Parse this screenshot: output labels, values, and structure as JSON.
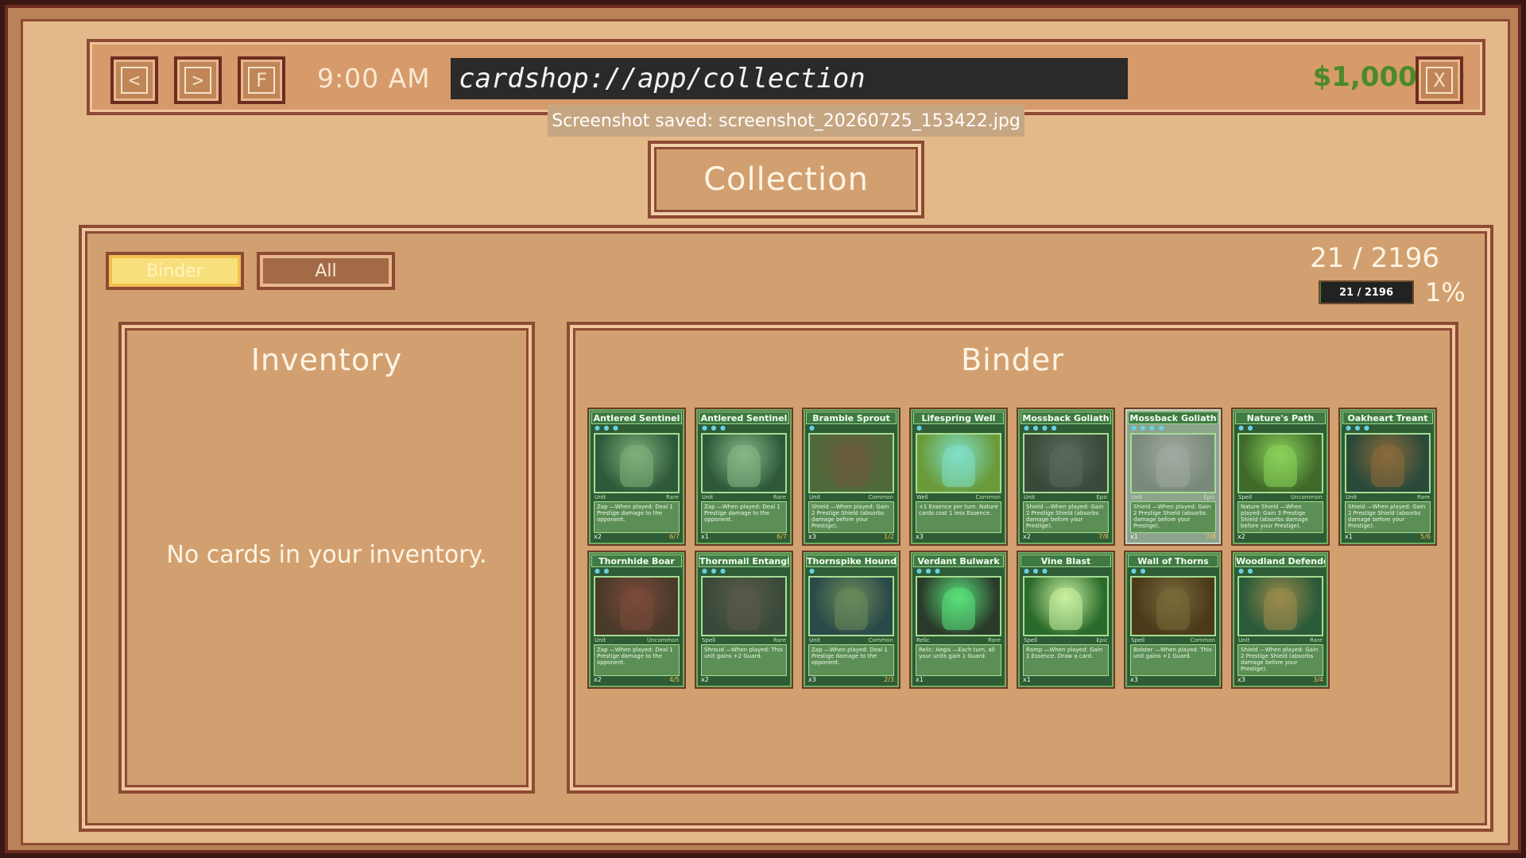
{
  "topbar": {
    "back_label": "<",
    "forward_label": ">",
    "fav_label": "F",
    "clock": "9:00 AM",
    "address": "cardshop://app/collection",
    "money": "$1,000.00",
    "close_label": "X"
  },
  "toast": "Screenshot saved: screenshot_20260725_153422.jpg",
  "page_title": "Collection",
  "filters": {
    "binder_label": "Binder",
    "all_label": "All",
    "active": "Binder"
  },
  "progress": {
    "count_text": "21 / 2196",
    "bar_label": "21 / 2196",
    "fraction": 0.0096,
    "percent_text": "1%"
  },
  "inventory": {
    "title": "Inventory",
    "empty_message": "No cards in your inventory."
  },
  "binder": {
    "title": "Binder",
    "cards": [
      {
        "name": "Antlered Sentinel",
        "pips": "● ● ●",
        "type": "Unit",
        "rarity": "Rare",
        "text": "Zap —When played: Deal 1 Prestige damage to the opponent.",
        "qty": "x2",
        "stats": "6/7",
        "art_bg": "#2f5a3a",
        "art_fg": "#7fb07a",
        "faded": false
      },
      {
        "name": "Antlered Sentinel",
        "pips": "● ● ●",
        "type": "Unit",
        "rarity": "Rare",
        "text": "Zap —When played: Deal 1 Prestige damage to the opponent.",
        "qty": "x1",
        "stats": "6/7",
        "art_bg": "#2f5a3a",
        "art_fg": "#86b886",
        "faded": false
      },
      {
        "name": "Bramble Sprout",
        "pips": "●",
        "type": "Unit",
        "rarity": "Common",
        "text": "Shield —When played: Gain 2 Prestige Shield (absorbs damage before your Prestige).",
        "qty": "x3",
        "stats": "1/2",
        "art_bg": "#4f6a3a",
        "art_fg": "#6a5a3a",
        "faded": false
      },
      {
        "name": "Lifespring Well",
        "pips": "●",
        "type": "Well",
        "rarity": "Common",
        "text": "+1 Essence per turn. Nature cards cost 1 less Essence.",
        "qty": "x3",
        "stats": "",
        "art_bg": "#6a9a3a",
        "art_fg": "#7fe0c8",
        "faded": false
      },
      {
        "name": "Mossback Goliath",
        "pips": "● ● ● ●",
        "type": "Unit",
        "rarity": "Epic",
        "text": "Shield —When played: Gain 2 Prestige Shield (absorbs damage before your Prestige).",
        "qty": "x2",
        "stats": "7/8",
        "art_bg": "#3a4a3a",
        "art_fg": "#5a6a5a",
        "faded": false
      },
      {
        "name": "Mossback Goliath",
        "pips": "● ● ● ●",
        "type": "Unit",
        "rarity": "Epic",
        "text": "Shield —When played: Gain 2 Prestige Shield (absorbs damage before your Prestige).",
        "qty": "x1",
        "stats": "7/8",
        "art_bg": "#7a8a7a",
        "art_fg": "#a0aaa0",
        "faded": true
      },
      {
        "name": "Nature's Path",
        "pips": "● ●",
        "type": "Spell",
        "rarity": "Uncommon",
        "text": "Nature Shield —When played: Gain 3 Prestige Shield (absorbs damage before your Prestige).",
        "qty": "x2",
        "stats": "",
        "art_bg": "#3f6a2a",
        "art_fg": "#8ad25a",
        "faded": false
      },
      {
        "name": "Oakheart Treant",
        "pips": "● ● ●",
        "type": "Unit",
        "rarity": "Rare",
        "text": "Shield —When played: Gain 2 Prestige Shield (absorbs damage before your Prestige).",
        "qty": "x1",
        "stats": "5/6",
        "art_bg": "#2a4a3a",
        "art_fg": "#8a6a3a",
        "faded": false
      },
      {
        "name": "Thornhide Boar",
        "pips": "● ●",
        "type": "Unit",
        "rarity": "Uncommon",
        "text": "Zap —When played: Deal 1 Prestige damage to the opponent.",
        "qty": "x2",
        "stats": "4/5",
        "art_bg": "#4a3a2a",
        "art_fg": "#7a4a3a",
        "faded": false
      },
      {
        "name": "Thornmail Entanglement",
        "pips": "● ● ●",
        "type": "Spell",
        "rarity": "Rare",
        "text": "Shroud —When played: This unit gains +2 Guard.",
        "qty": "x2",
        "stats": "",
        "art_bg": "#3a4a3a",
        "art_fg": "#5a5a4a",
        "faded": false
      },
      {
        "name": "Thornspike Hound",
        "pips": "●",
        "type": "Unit",
        "rarity": "Common",
        "text": "Zap —When played: Deal 1 Prestige damage to the opponent.",
        "qty": "x3",
        "stats": "2/3",
        "art_bg": "#2a4a4a",
        "art_fg": "#6a8a5a",
        "faded": false
      },
      {
        "name": "Verdant Bulwark",
        "pips": "● ● ●",
        "type": "Relic",
        "rarity": "Rare",
        "text": "Relic: Aegis —Each turn, all your units gain 1 Guard.",
        "qty": "x1",
        "stats": "",
        "art_bg": "#2a3a2a",
        "art_fg": "#5ae07a",
        "faded": false
      },
      {
        "name": "Vine Blast",
        "pips": "● ● ●",
        "type": "Spell",
        "rarity": "Epic",
        "text": "Ramp —When played: Gain 1 Essence. Draw a card.",
        "qty": "x1",
        "stats": "",
        "art_bg": "#2a6a2a",
        "art_fg": "#c8f0a0",
        "faded": false
      },
      {
        "name": "Wall of Thorns",
        "pips": "● ●",
        "type": "Spell",
        "rarity": "Common",
        "text": "Bolster —When played: This unit gains +1 Guard.",
        "qty": "x3",
        "stats": "",
        "art_bg": "#4a3a1a",
        "art_fg": "#7a6a3a",
        "faded": false
      },
      {
        "name": "Woodland Defender",
        "pips": "● ●",
        "type": "Unit",
        "rarity": "Rare",
        "text": "Shield —When played: Gain 2 Prestige Shield (absorbs damage before your Prestige).",
        "qty": "x3",
        "stats": "3/4",
        "art_bg": "#2a5a3a",
        "art_fg": "#9a8a4a",
        "faded": false
      }
    ]
  }
}
